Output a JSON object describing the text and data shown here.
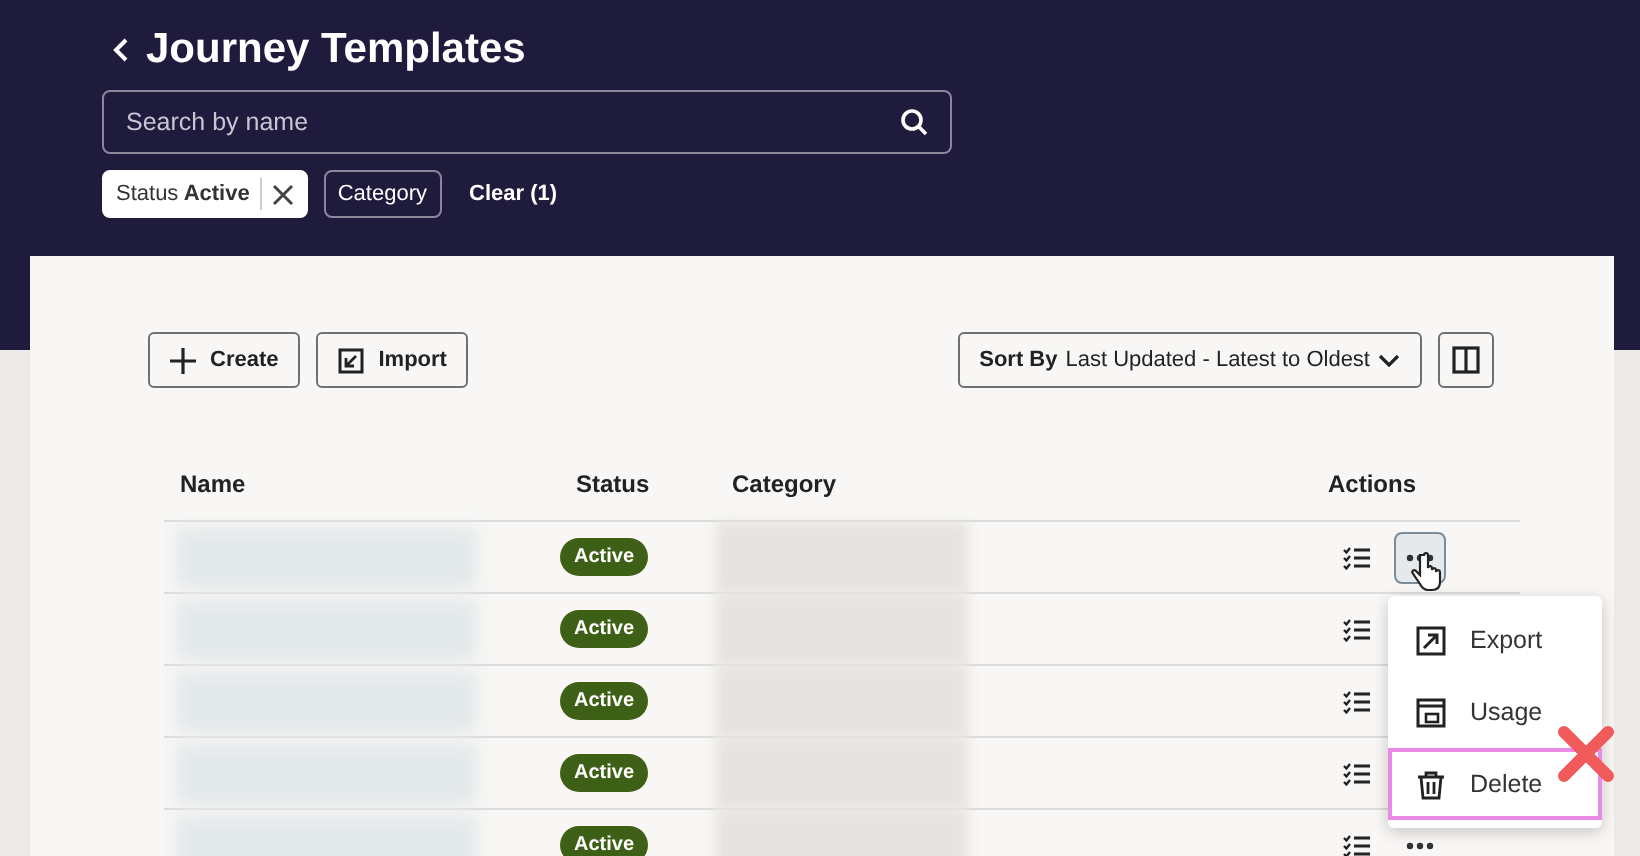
{
  "header": {
    "title": "Journey Templates",
    "search": {
      "placeholder": "Search by name"
    },
    "filters": [
      {
        "label": "Status",
        "value": "Active",
        "selected": true
      },
      {
        "label": "Category",
        "selected": false
      }
    ],
    "clear": "Clear (1)"
  },
  "toolbar": {
    "buttons": [
      {
        "kind": "create",
        "label": "Create"
      },
      {
        "kind": "import",
        "label": "Import"
      }
    ],
    "sort": {
      "label": "Sort By",
      "value": "Last Updated - Latest to Oldest"
    }
  },
  "table": {
    "columns": [
      "Name",
      "Status",
      "Category",
      "Actions"
    ],
    "rows": [
      {
        "status": "Active",
        "menu_open": true
      },
      {
        "status": "Active"
      },
      {
        "status": "Active"
      },
      {
        "status": "Active"
      },
      {
        "status": "Active",
        "menu_open": false
      }
    ]
  },
  "menu": {
    "items": [
      {
        "kind": "export",
        "label": "Export",
        "highlighted": false
      },
      {
        "kind": "usage",
        "label": "Usage",
        "highlighted": false
      },
      {
        "kind": "delete",
        "label": "Delete",
        "highlighted": true
      }
    ]
  }
}
